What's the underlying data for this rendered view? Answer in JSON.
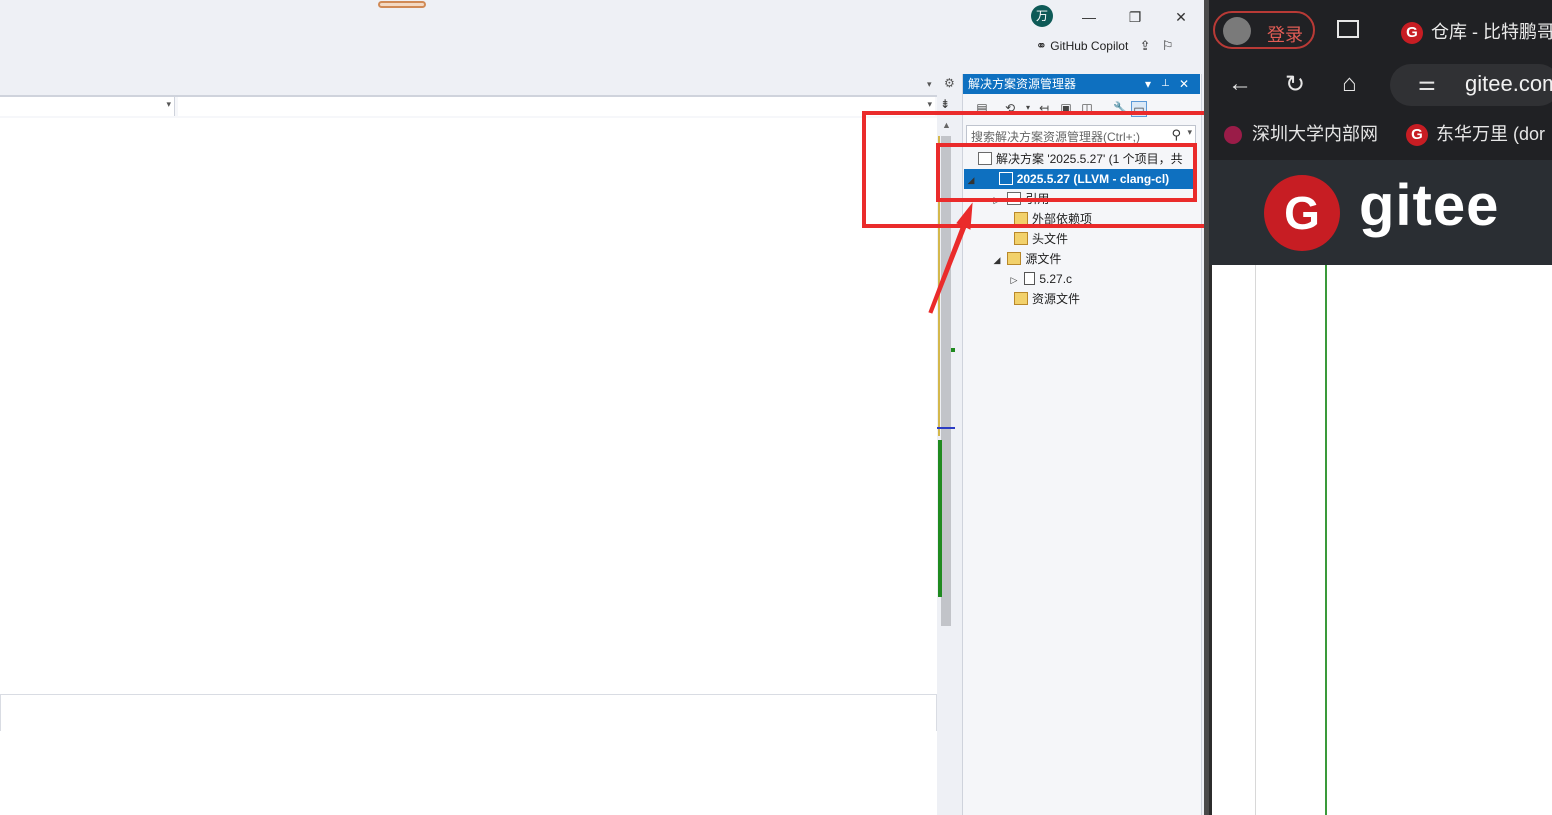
{
  "vs": {
    "account_initial": "万",
    "window_controls": {
      "minimize": "—",
      "restore": "❐",
      "close": "✕"
    },
    "copilot_label": "GitHub Copilot",
    "solution_explorer": {
      "title": "解决方案资源管理器",
      "title_buttons": {
        "dropdown": "▾",
        "pin": "📌",
        "close": "✕"
      },
      "search_placeholder": "搜索解决方案资源管理器(Ctrl+;)",
      "tree": [
        {
          "label": "解决方案 '2025.5.27' (1 个项目，共",
          "icon": "solution-icon"
        },
        {
          "label": "2025.5.27 (LLVM - clang-cl)",
          "icon": "project-icon",
          "selected": true,
          "expanded": true
        },
        {
          "label": "引用",
          "icon": "references-icon",
          "expanded": false
        },
        {
          "label": "外部依赖项",
          "icon": "external-deps-icon"
        },
        {
          "label": "头文件",
          "icon": "folder-filter-icon"
        },
        {
          "label": "源文件",
          "icon": "folder-filter-icon",
          "expanded": true
        },
        {
          "label": "5.27.c",
          "icon": "c-file-icon",
          "expanded": false
        },
        {
          "label": "资源文件",
          "icon": "folder-filter-icon"
        }
      ]
    }
  },
  "browser": {
    "login_label": "登录",
    "tab_title": "仓库 - 比特鹏哥",
    "url": "gitee.com",
    "bookmarks": [
      {
        "label": "深圳大学内部网"
      },
      {
        "label": "东华万里 (dor"
      }
    ],
    "banner_word": "gitee",
    "banner_logo": "G"
  },
  "colors": {
    "accent_blue": "#0e70c0",
    "annotation_red": "#ea2b2b",
    "gitee_red": "#c71d23"
  }
}
